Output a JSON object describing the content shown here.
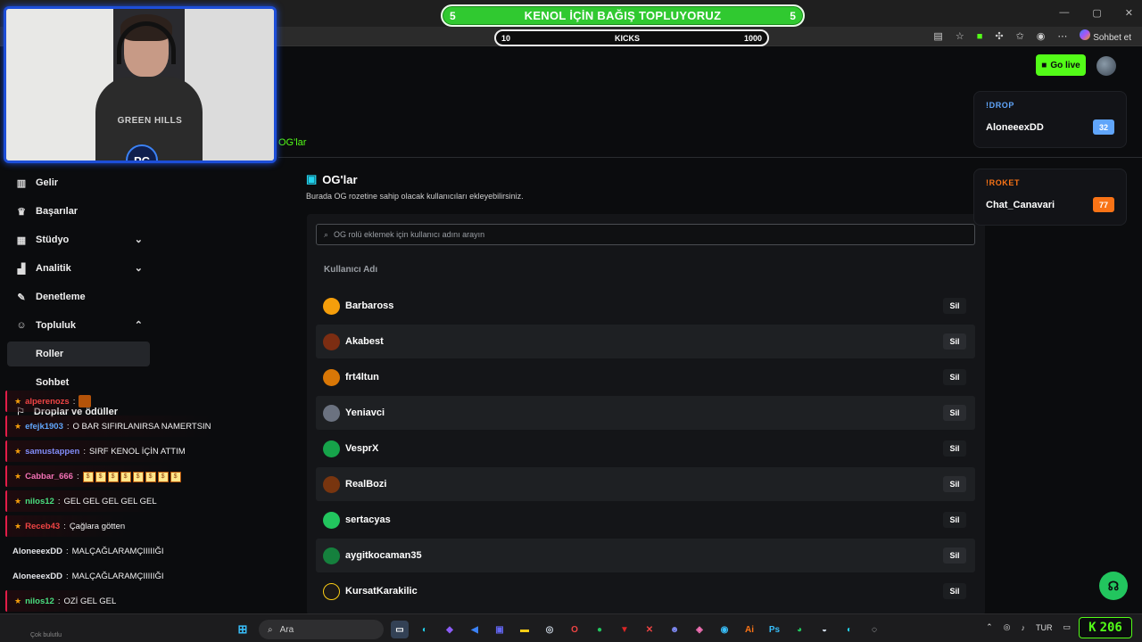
{
  "donation": {
    "left": "5",
    "title": "KENOL İÇİN BAĞIŞ TOPLUYORUZ",
    "right": "5",
    "kicks_min": "10",
    "kicks_label": "KICKS",
    "kicks_max": "1000"
  },
  "browser": {
    "profile_label": "Sohbet et"
  },
  "webcam": {
    "shirt_text": "GREEN HILLS",
    "logo_text": "PC"
  },
  "header": {
    "go_live": "Go live"
  },
  "tabs": {
    "active": "OG'lar"
  },
  "sidebar": {
    "items": [
      {
        "label": "Gelir",
        "icon": "chart-icon"
      },
      {
        "label": "Başarılar",
        "icon": "trophy-icon"
      },
      {
        "label": "Stüdyo",
        "icon": "studio-icon",
        "chevron": "down"
      },
      {
        "label": "Analitik",
        "icon": "analytics-icon",
        "chevron": "down"
      },
      {
        "label": "Denetleme",
        "icon": "wrench-icon"
      },
      {
        "label": "Topluluk",
        "icon": "community-icon",
        "chevron": "up"
      },
      {
        "label": "Roller"
      },
      {
        "label": "Sohbet"
      },
      {
        "label": "Droplar ve ödüller",
        "icon": "gift-icon"
      }
    ]
  },
  "og": {
    "title": "OG'lar",
    "description": "Burada OG rozetine sahip olacak kullanıcıları ekleyebilirsiniz.",
    "search_placeholder": "OG rolü eklemek için kullanıcı adını arayın",
    "column_header": "Kullanıcı Adı",
    "delete_label": "Sil",
    "users": [
      {
        "name": "Barbaross",
        "color": "#f59e0b"
      },
      {
        "name": "Akabest",
        "color": "#7c2d12"
      },
      {
        "name": "frt4ltun",
        "color": "#d97706"
      },
      {
        "name": "Yeniavci",
        "color": "#6b7280"
      },
      {
        "name": "VesprX",
        "color": "#16a34a"
      },
      {
        "name": "RealBozi",
        "color": "#78350f"
      },
      {
        "name": "sertacyas",
        "color": "#22c55e"
      },
      {
        "name": "aygitkocaman35",
        "color": "#15803d"
      },
      {
        "name": "KursatKarakilic",
        "color": "#1c1917"
      }
    ]
  },
  "widgets": {
    "drop": {
      "label": "!DROP",
      "user": "AloneeexDD",
      "count": "32",
      "color": "#60a5fa",
      "badge": "#60a5fa"
    },
    "roket": {
      "label": "!ROKET",
      "user": "Chat_Canavari",
      "count": "77",
      "color": "#f97316",
      "badge": "#f97316"
    }
  },
  "chat": [
    {
      "name": "alperenozs",
      "sep": ":",
      "msg": "",
      "color": "#ef4444",
      "badge": true,
      "bar": true
    },
    {
      "name": "efejk1903",
      "sep": ":",
      "msg": "O BAR SIFIRLANIRSA NAMERTSIN",
      "color": "#60a5fa",
      "badge": true,
      "bar": true
    },
    {
      "name": "samustappen",
      "sep": ":",
      "msg": "SIRF KENOL İÇİN ATTIM",
      "color": "#818cf8",
      "badge": true,
      "bar": true
    },
    {
      "name": "Cabbar_666",
      "sep": ":",
      "msg": "",
      "color": "#f472b6",
      "badge": true,
      "bar": true,
      "coins": 8
    },
    {
      "name": "nilos12",
      "sep": ":",
      "msg": "GEL GEL GEL GEL GEL",
      "color": "#4ade80",
      "badge": true,
      "bar": true
    },
    {
      "name": "Receb43",
      "sep": ":",
      "msg": "Çağlara götten",
      "color": "#ef4444",
      "badge": true,
      "bar": true
    },
    {
      "name": "AloneeexDD",
      "sep": ":",
      "msg": "MALÇAĞLARAMÇIIIIIĞI",
      "color": "#e5e7eb",
      "badge": false,
      "bar": false
    },
    {
      "name": "AloneeexDD",
      "sep": ":",
      "msg": "MALÇAĞLARAMÇIIIIIĞI",
      "color": "#e5e7eb",
      "badge": false,
      "bar": false
    },
    {
      "name": "nilos12",
      "sep": ":",
      "msg": "OZİ GEL GEL",
      "color": "#4ade80",
      "badge": true,
      "bar": true
    },
    {
      "name": "AloneeexDD",
      "sep": ":",
      "msg": "MALÇAĞLARAMÇIIIIIĞI",
      "color": "#e5e7eb",
      "badge": false,
      "bar": false
    }
  ],
  "taskbar": {
    "weather_sub": "Çok bulutlu",
    "search": "Ara",
    "lang": "TUR",
    "kick_count": "206"
  }
}
